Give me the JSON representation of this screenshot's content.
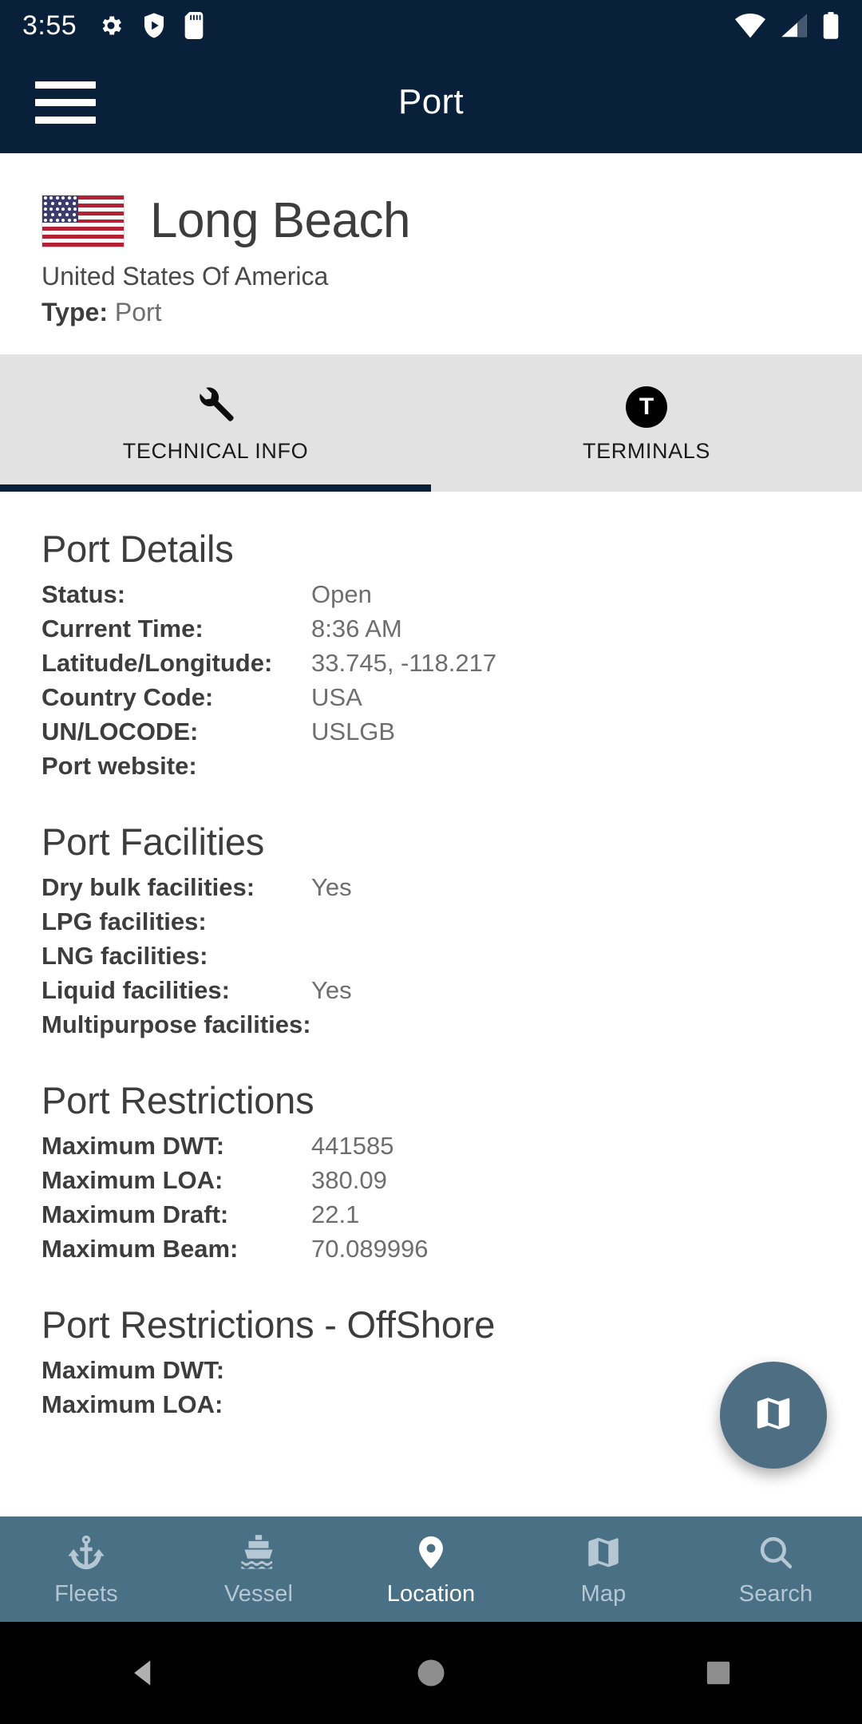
{
  "status_bar": {
    "time": "3:55",
    "left_icons": [
      "gear-icon",
      "shield-play-icon",
      "sd-card-icon"
    ],
    "right_icons": [
      "wifi-icon",
      "cellular-signal-icon",
      "battery-icon"
    ]
  },
  "app_bar": {
    "menu_icon": "hamburger-menu-icon",
    "title": "Port"
  },
  "port_header": {
    "flag": "united-states-flag",
    "name": "Long Beach",
    "country": "United States Of America",
    "type_label": "Type:",
    "type_value": "Port"
  },
  "tabs": [
    {
      "label": "TECHNICAL INFO",
      "icon": "wrench-icon",
      "active": true
    },
    {
      "label": "TERMINALS",
      "icon": "terminal-badge-icon",
      "badge": "T",
      "active": false
    }
  ],
  "sections": [
    {
      "title": "Port Details",
      "rows": [
        {
          "key": "Status:",
          "value": "Open"
        },
        {
          "key": "Current Time:",
          "value": "8:36 AM"
        },
        {
          "key": "Latitude/Longitude:",
          "value": "33.745, -118.217"
        },
        {
          "key": "Country Code:",
          "value": "USA"
        },
        {
          "key": "UN/LOCODE:",
          "value": "USLGB"
        },
        {
          "key": "Port website:",
          "value": ""
        }
      ]
    },
    {
      "title": "Port Facilities",
      "rows": [
        {
          "key": "Dry bulk facilities:",
          "value": "Yes"
        },
        {
          "key": "LPG facilities:",
          "value": ""
        },
        {
          "key": "LNG facilities:",
          "value": ""
        },
        {
          "key": "Liquid facilities:",
          "value": "Yes"
        },
        {
          "key": "Multipurpose facilities:",
          "value": ""
        }
      ]
    },
    {
      "title": "Port Restrictions",
      "rows": [
        {
          "key": "Maximum DWT:",
          "value": "441585"
        },
        {
          "key": "Maximum LOA:",
          "value": "380.09"
        },
        {
          "key": "Maximum Draft:",
          "value": "22.1"
        },
        {
          "key": "Maximum Beam:",
          "value": "70.089996"
        }
      ]
    },
    {
      "title": "Port Restrictions - OffShore",
      "rows": [
        {
          "key": "Maximum DWT:",
          "value": ""
        },
        {
          "key": "Maximum LOA:",
          "value": ""
        }
      ]
    }
  ],
  "fab": {
    "icon": "map-icon"
  },
  "bottom_nav": [
    {
      "label": "Fleets",
      "icon": "anchor-icon",
      "active": false
    },
    {
      "label": "Vessel",
      "icon": "ship-icon",
      "active": false
    },
    {
      "label": "Location",
      "icon": "map-pin-icon",
      "active": true
    },
    {
      "label": "Map",
      "icon": "map-icon",
      "active": false
    },
    {
      "label": "Search",
      "icon": "search-icon",
      "active": false
    }
  ],
  "system_nav": [
    {
      "icon": "back-triangle-icon"
    },
    {
      "icon": "home-circle-icon"
    },
    {
      "icon": "recents-square-icon"
    }
  ],
  "colors": {
    "app_bar": "#08203A",
    "tab_bar": "#e2e2e2",
    "accent": "#08203A",
    "bottom_nav": "#4a7086",
    "fab": "#4e6e84"
  }
}
